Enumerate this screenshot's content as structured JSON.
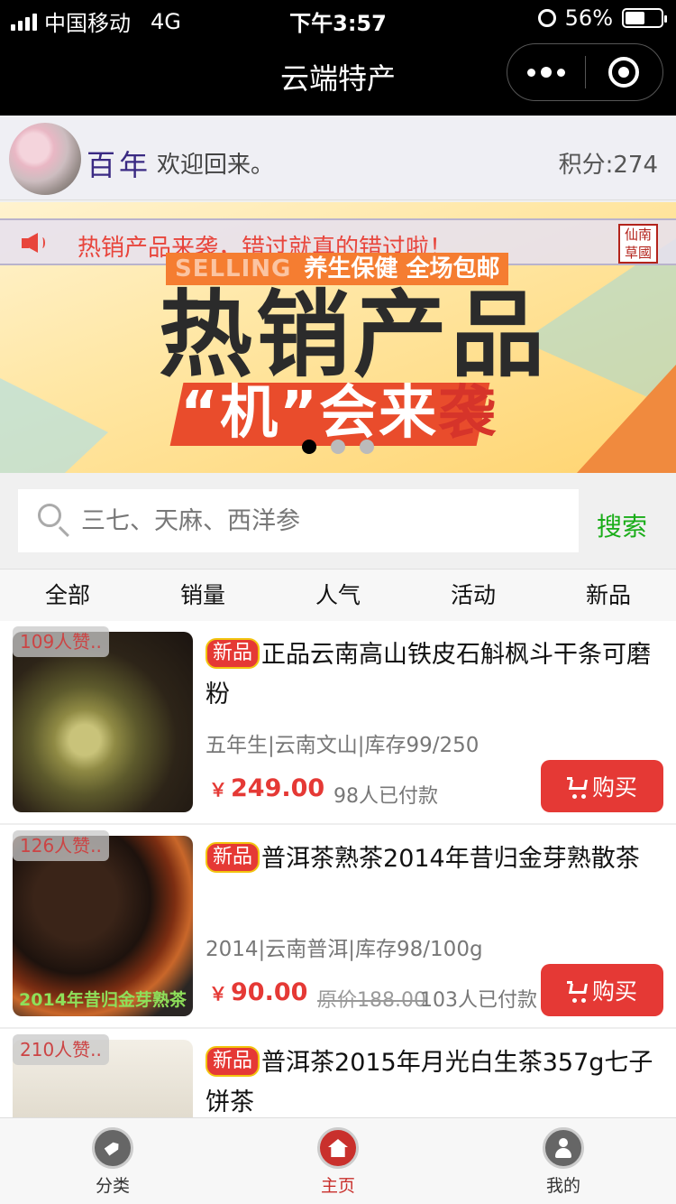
{
  "status_bar": {
    "carrier": "中国移动",
    "network": "4G",
    "time": "下午3:57",
    "battery": "56%",
    "battery_level": 0.56
  },
  "nav": {
    "title": "云端特产",
    "icons": [
      "more-dots-icon",
      "close-target-icon"
    ]
  },
  "user": {
    "name": "百年",
    "welcome": "欢迎回来。",
    "points": "积分:274"
  },
  "banner": {
    "notice": "热销产品来袭，错过就真的错过啦！",
    "seal": "仙南草國",
    "tag_en": "SELLING",
    "tag_cn": "养生保健 全场包邮",
    "headline": "热销产品",
    "sub": "“机”会来",
    "sub_last": "袭",
    "slide_count": 3,
    "active_slide": 1,
    "colors": {
      "accent": "#f57d31",
      "strip": "#e94c2c",
      "notice": "#e8453c"
    }
  },
  "search": {
    "placeholder": "三七、天麻、西洋参",
    "value": "",
    "button": "搜索"
  },
  "tabs": [
    "全部",
    "销量",
    "人气",
    "活动",
    "新品"
  ],
  "products": [
    {
      "likes": "109人赞..",
      "badge": "新品",
      "title": "正品云南高山铁皮石斛枫斗干条可磨粉",
      "meta": "五年生|云南文山|库存99/250",
      "price_symbol": "￥",
      "price": "249.00",
      "original": "",
      "paid": "98人已付款",
      "buy": "购买",
      "caption": ""
    },
    {
      "likes": "126人赞..",
      "badge": "新品",
      "title": "普洱茶熟茶2014年昔归金芽熟散茶",
      "meta": "2014|云南普洱|库存98/100g",
      "price_symbol": "￥",
      "price": "90.00",
      "original": "原价188.00",
      "paid": "103人已付款",
      "buy": "购买",
      "caption": "2014年昔归金芽熟茶"
    },
    {
      "likes": "210人赞..",
      "badge": "新品",
      "title": "普洱茶2015年月光白生茶357g七子饼茶",
      "meta": "",
      "price_symbol": "",
      "price": "",
      "original": "",
      "paid": "",
      "buy": "",
      "caption": ""
    }
  ],
  "tab_bar": [
    {
      "label": "分类",
      "icon": "category-tag-icon",
      "active": false
    },
    {
      "label": "主页",
      "icon": "home-icon",
      "active": true
    },
    {
      "label": "我的",
      "icon": "user-icon",
      "active": false
    }
  ]
}
